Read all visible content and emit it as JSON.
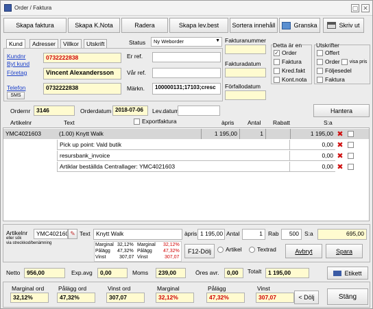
{
  "window": {
    "title": "Order / Faktura"
  },
  "toolbar": {
    "skapa_faktura": "Skapa faktura",
    "skapa_knota": "Skapa K.Nota",
    "radera": "Radera",
    "skapa_levbest": "Skapa lev.best",
    "sortera": "Sortera innehåll",
    "granska": "Granska",
    "skriv_ut": "Skriv ut"
  },
  "tabs": [
    "Kund",
    "Adresser",
    "Villkor",
    "Utskrift"
  ],
  "customer": {
    "kundnr_label": "Kundnr",
    "byt_kund_label": "Byt kund",
    "foretag_label": "Företag",
    "telefon_label": "Telefon",
    "sms_label": "SMS",
    "kundnr": "0732222838",
    "foretag": "Vincent Alexandersson",
    "telefon": "0732222838"
  },
  "status": {
    "label": "Status",
    "value": "Ny Weborder"
  },
  "refs": {
    "er_ref_label": "Er ref.",
    "var_ref_label": "Vår ref.",
    "markn_label": "Märkn.",
    "er_ref": "",
    "var_ref": "",
    "markn": "100000131;17103;cresc"
  },
  "invoice": {
    "fakturanummer_label": "Fakturanummer",
    "fakturadatum_label": "Fakturadatum",
    "forfallodatum_label": "Förfallodatum",
    "fakturanummer": "",
    "fakturadatum": "",
    "forfallodatum": ""
  },
  "detta_ar": {
    "title": "Detta är en",
    "order": "Order",
    "faktura": "Faktura",
    "kred_fakt": "Kred.fakt",
    "kont_nota": "Kont.nota"
  },
  "utskrifter": {
    "title": "Utskrifter",
    "offert": "Offert",
    "order": "Order",
    "visa_pris": "visa pris",
    "foljesedel": "Följesedel",
    "faktura": "Faktura"
  },
  "order_info": {
    "ordernr_label": "Ordernr",
    "ordernr": "3146",
    "orderdatum_label": "Orderdatum",
    "orderdatum": "2018-07-06",
    "levdatum_label": "Lev.datum",
    "levdatum": "",
    "hantera": "Hantera",
    "exportfaktura": "Exportfaktura"
  },
  "columns": {
    "artikelnr": "Artikelnr",
    "text": "Text",
    "apris": "àpris",
    "antal": "Antal",
    "rabatt": "Rabatt",
    "sa": "S:a"
  },
  "rows": [
    {
      "artikelnr": "YMC4021603",
      "text": "(1.00) Knytt Walk",
      "apris": "1 195,00",
      "antal": "1",
      "rabatt": "",
      "sa": "1 195,00"
    },
    {
      "artikelnr": "",
      "text": "Pick up point: Vald butik",
      "apris": "",
      "antal": "",
      "rabatt": "",
      "sa": "0,00"
    },
    {
      "artikelnr": "",
      "text": "resursbank_invoice",
      "apris": "",
      "antal": "",
      "rabatt": "",
      "sa": "0,00"
    },
    {
      "artikelnr": "",
      "text": "Artiklar beställda Centrallager: YMC4021603",
      "apris": "",
      "antal": "",
      "rabatt": "",
      "sa": "0,00"
    }
  ],
  "edit": {
    "artikelnr_label": "Artikelnr",
    "eller_sok": "eller sök",
    "via_streckkod": "via streckkod/benämning",
    "artikelnr": "YMC4021603",
    "text_label": "Text",
    "text": "Knytt Walk",
    "apris_label": "àpris",
    "apris": "1 195,00",
    "antal_label": "Antal",
    "antal": "1",
    "rab_label": "Rab",
    "rab": "500",
    "sa_label": "S:a",
    "sa": "695,00",
    "marginal_label": "Marginal",
    "marginal_val": "32,12%",
    "marginal2_label": "Marginal",
    "marginal2_val": "32,12%",
    "palagg_label": "Pålägg",
    "palagg_val": "47,32%",
    "palagg2_label": "Pålägg",
    "palagg2_val": "47,32%",
    "vinst_label": "Vinst",
    "vinst_val": "307,07",
    "vinst2_label": "Vinst",
    "vinst2_val": "307,07",
    "f12": "F12-Dölj",
    "artikel": "Artikel",
    "textrad": "Textrad",
    "avbryt": "Avbryt",
    "spara": "Spara"
  },
  "totals": {
    "netto_label": "Netto",
    "netto": "956,00",
    "exp_avg_label": "Exp.avg",
    "exp_avg": "0,00",
    "moms_label": "Moms",
    "moms": "239,00",
    "ores_label": "Öres avr.",
    "ores": "0,00",
    "totalt_label": "Totalt",
    "totalt": "1 195,00",
    "etikett": "Etikett"
  },
  "summary": {
    "marginal_ord_label": "Marginal ord",
    "marginal_ord": "32,12%",
    "palagg_ord_label": "Pålägg ord",
    "palagg_ord": "47,32%",
    "vinst_ord_label": "Vinst ord",
    "vinst_ord": "307,07",
    "marginal_label": "Marginal",
    "marginal": "32,12%",
    "palagg_label": "Pålägg",
    "palagg": "47,32%",
    "vinst_label": "Vinst",
    "vinst": "307,07",
    "dolj": "< Dölj",
    "stang": "Stäng"
  },
  "colors": {
    "yellow_field": "#fffbd0",
    "red_text": "#d00000",
    "link_blue": "#1a3fc9"
  }
}
